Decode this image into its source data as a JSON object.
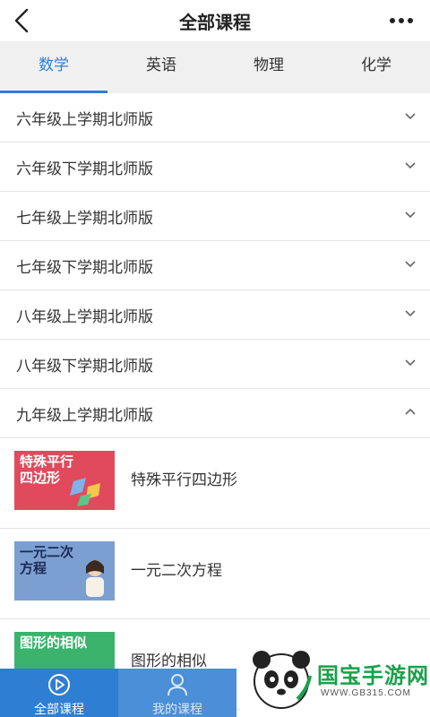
{
  "header": {
    "title": "全部课程"
  },
  "tabs": [
    {
      "label": "数学",
      "active": true
    },
    {
      "label": "英语",
      "active": false
    },
    {
      "label": "物理",
      "active": false
    },
    {
      "label": "化学",
      "active": false
    }
  ],
  "grades": [
    {
      "label": "六年级上学期北师版",
      "expanded": false
    },
    {
      "label": "六年级下学期北师版",
      "expanded": false
    },
    {
      "label": "七年级上学期北师版",
      "expanded": false
    },
    {
      "label": "七年级下学期北师版",
      "expanded": false
    },
    {
      "label": "八年级上学期北师版",
      "expanded": false
    },
    {
      "label": "八年级下学期北师版",
      "expanded": false
    },
    {
      "label": "九年级上学期北师版",
      "expanded": true
    }
  ],
  "courses": [
    {
      "name": "特殊平行四边形",
      "thumb_text_line1": "特殊平行",
      "thumb_text_line2": "四边形",
      "thumb_bg": "#e04a5c",
      "thumb_fg": "#ffffff"
    },
    {
      "name": "一元二次方程",
      "thumb_text_line1": "一元二次",
      "thumb_text_line2": "方程",
      "thumb_bg": "#7b9fd0",
      "thumb_fg": "#1c2a56"
    },
    {
      "name": "图形的相似",
      "thumb_text_line1": "图形的相似",
      "thumb_text_line2": "",
      "thumb_bg": "#3bb36c",
      "thumb_fg": "#ffffff"
    }
  ],
  "bottom_nav": [
    {
      "label": "全部课程",
      "icon": "play-circle-icon",
      "active": true
    },
    {
      "label": "我的课程",
      "icon": "user-icon",
      "active": false
    }
  ],
  "watermark": {
    "text": "国宝手游网",
    "url": "WWW.GB315.COM"
  },
  "colors": {
    "accent": "#2e7ed3",
    "tab_bg": "#f0f0f0",
    "divider": "#e3e3e3"
  }
}
